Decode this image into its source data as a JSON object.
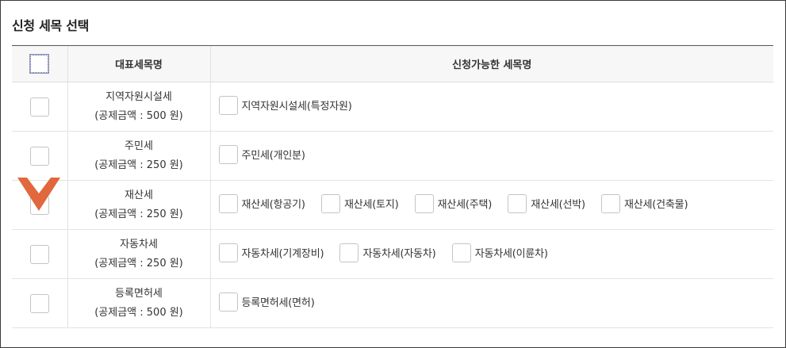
{
  "section": {
    "title": "신청 세목 선택"
  },
  "table": {
    "headers": {
      "rep": "대표세목명",
      "items": "신청가능한 세목명"
    },
    "rows": [
      {
        "name": "지역자원시설세",
        "deduction": "(공제금액 : 500 원)",
        "items": [
          "지역자원시설세(특정자원)"
        ]
      },
      {
        "name": "주민세",
        "deduction": "(공제금액 : 250 원)",
        "items": [
          "주민세(개인분)"
        ]
      },
      {
        "name": "재산세",
        "deduction": "(공제금액 : 250 원)",
        "items": [
          "재산세(항공기)",
          "재산세(토지)",
          "재산세(주택)",
          "재산세(선박)",
          "재산세(건축물)"
        ]
      },
      {
        "name": "자동차세",
        "deduction": "(공제금액 : 250 원)",
        "items": [
          "자동차세(기계장비)",
          "자동차세(자동차)",
          "자동차세(이륜차)"
        ]
      },
      {
        "name": "등록면허세",
        "deduction": "(공제금액 : 500 원)",
        "items": [
          "등록면허세(면허)"
        ]
      }
    ]
  },
  "overlay": {
    "icon": "chevron-down-icon",
    "color": "#e0683c"
  }
}
